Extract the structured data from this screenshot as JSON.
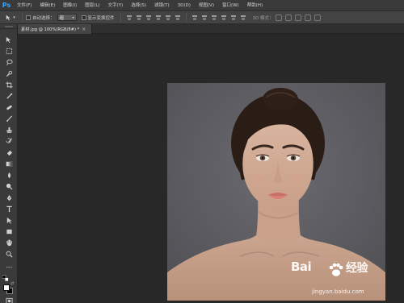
{
  "app": {
    "logo": "Ps",
    "brand_color": "#31a8ff"
  },
  "menu": [
    "文件(F)",
    "编辑(E)",
    "图像(I)",
    "图层(L)",
    "文字(Y)",
    "选择(S)",
    "滤镜(T)",
    "3D(D)",
    "视图(V)",
    "窗口(W)",
    "帮助(H)"
  ],
  "options": {
    "tool_icon": "move-tool-icon",
    "auto_select_label": "自动选择：",
    "auto_select_value": "组",
    "show_transform_label": "显示变换控件",
    "mode_3d_label": "3D 模式："
  },
  "document": {
    "tab_title": "素材.jpg @ 100%(RGB/8#) *",
    "close_glyph": "×"
  },
  "tools": [
    "move-tool-icon",
    "marquee-tool-icon",
    "lasso-tool-icon",
    "quick-select-tool-icon",
    "crop-tool-icon",
    "eyedropper-tool-icon",
    "healing-brush-tool-icon",
    "brush-tool-icon",
    "clone-stamp-tool-icon",
    "history-brush-tool-icon",
    "eraser-tool-icon",
    "gradient-tool-icon",
    "blur-tool-icon",
    "dodge-tool-icon",
    "pen-tool-icon",
    "type-tool-icon",
    "path-select-tool-icon",
    "rectangle-tool-icon",
    "hand-tool-icon",
    "zoom-tool-icon"
  ],
  "colors": {
    "foreground": "#ffffff",
    "background": "#000000",
    "workspace": "#282828",
    "panel": "#3a3a3a"
  },
  "watermark": {
    "logo_text": "Bai",
    "logo_text_2": "经验",
    "site": "jingyan.baidu.com"
  }
}
